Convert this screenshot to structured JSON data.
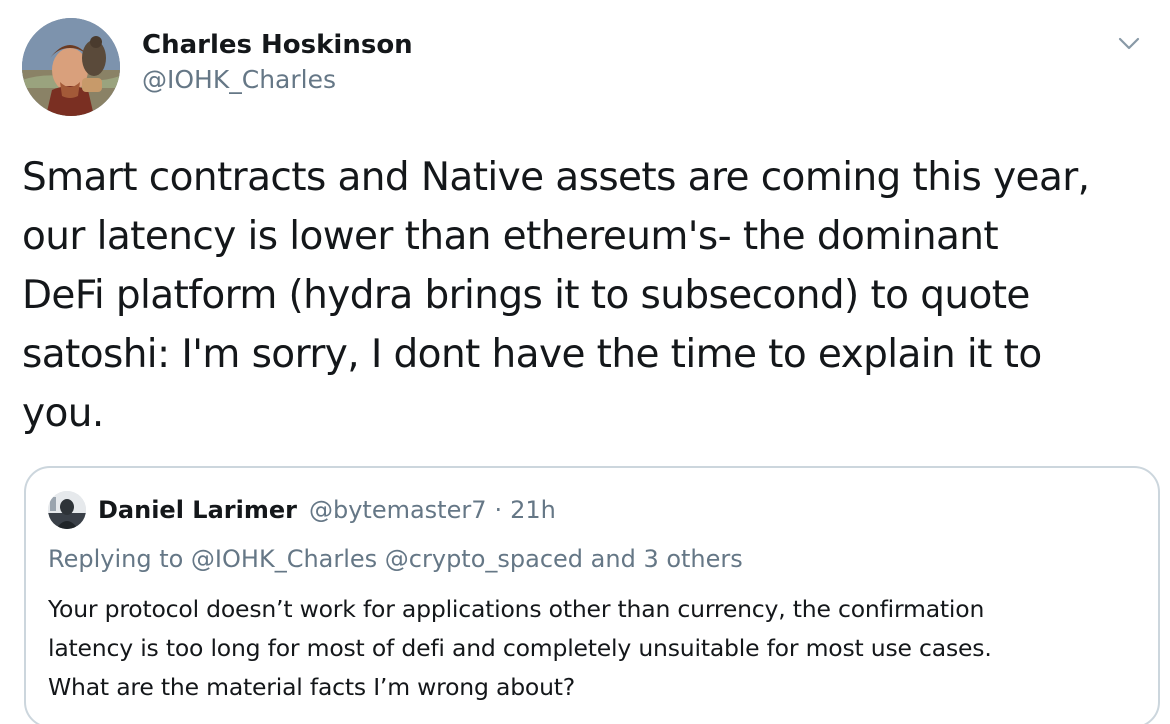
{
  "tweet": {
    "author_name": "Charles Hoskinson",
    "author_handle": "@IOHK_Charles",
    "text": "Smart contracts and Native assets are coming this year,\nour latency is lower than ethereum's- the dominant\nDeFi platform (hydra brings it to subsecond) to quote\nsatoshi: I'm sorry, I dont have the time to explain it to\nyou.",
    "menu_icon": "chevron-down-icon"
  },
  "quoted_tweet": {
    "author_name": "Daniel Larimer",
    "author_handle": "@bytemaster7",
    "separator": "·",
    "time": "21h",
    "replying_to": "Replying to @IOHK_Charles @crypto_spaced and 3 others",
    "text": "Your protocol doesn’t work for applications other than currency, the confirmation\nlatency is too long for most of defi and completely unsuitable for most use cases.\nWhat are the material facts I’m wrong about?"
  },
  "colors": {
    "text_primary": "#14171a",
    "text_secondary": "#657786",
    "border": "#ccd6dd"
  }
}
